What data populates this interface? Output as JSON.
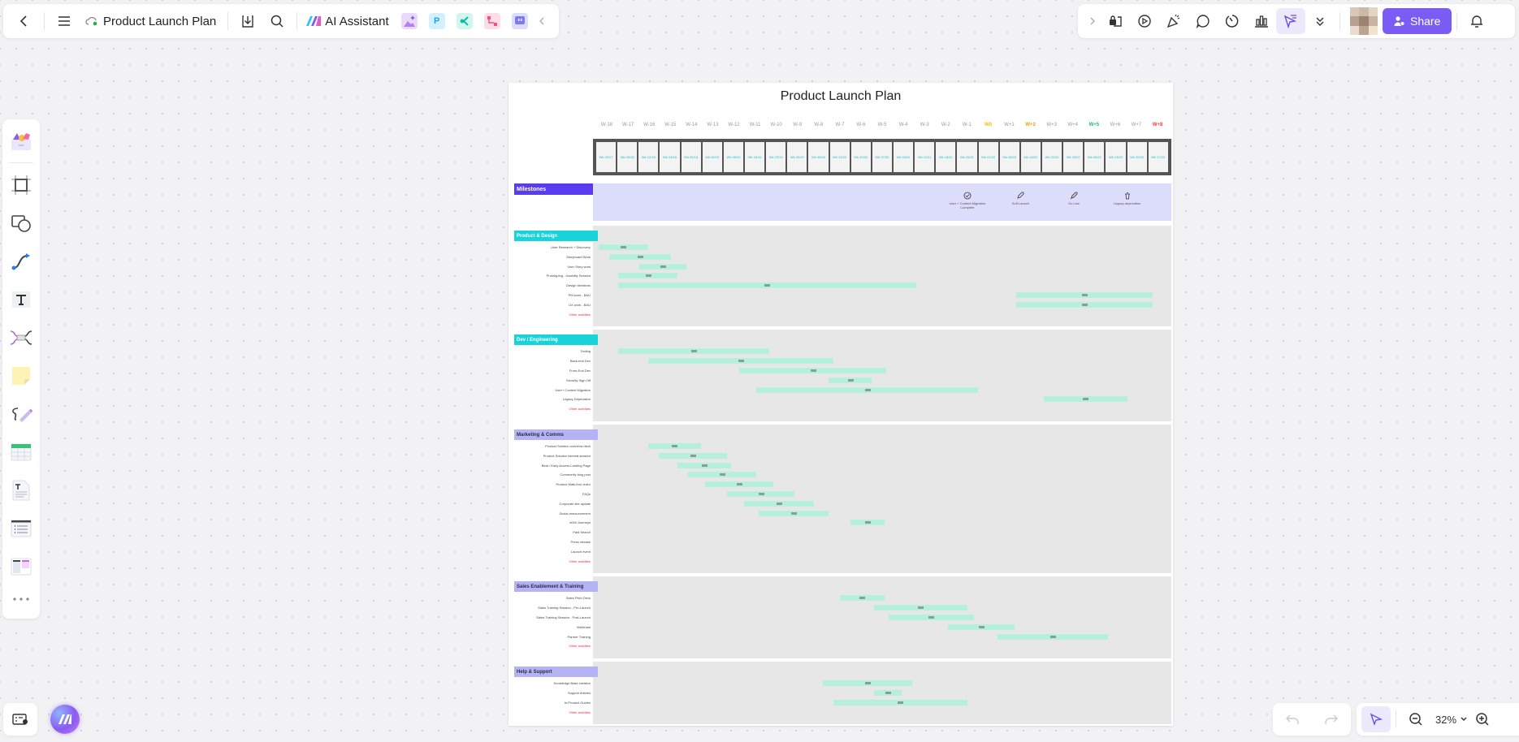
{
  "toolbar": {
    "doc_title": "Product Launch Plan",
    "ai_assistant_label": "AI Assistant",
    "share_label": "Share",
    "accent_color": "#7b5cf5"
  },
  "zoom": {
    "level": "32%"
  },
  "board": {
    "title": "Product Launch Plan",
    "weeks": [
      "W-18",
      "W-17",
      "W-16",
      "W-15",
      "W-14",
      "W-13",
      "W-12",
      "W-11",
      "W-10",
      "W-9",
      "W-8",
      "W-7",
      "W-6",
      "W-5",
      "W-4",
      "W-3",
      "W-2",
      "W-1",
      "W0",
      "W+1",
      "W+2",
      "W+3",
      "W+4",
      "W+5",
      "W+6",
      "W+7",
      "W+8"
    ],
    "week_colors": {
      "W0": "#f5c000",
      "W+2": "#f59a00",
      "W+5": "#19b88a",
      "W+8": "#f23b3b"
    },
    "dates": [
      "Wk 29/17",
      "Wk 05/18",
      "Wk 12/18",
      "Wk 19/18",
      "Wk 26/18",
      "Wk 02/19",
      "Wk 09/19",
      "Wk 16/19",
      "Wk 23/19",
      "Wk 30/19",
      "Wk 06/20",
      "Wk 13/20",
      "Wk 20/20",
      "Wk 27/20",
      "Wk 04/21",
      "Wk 11/21",
      "Wk 18/21",
      "Wk 25/21",
      "Wk 01/22",
      "Wk 08/22",
      "Wk 15/22",
      "Wk 22/22",
      "Wk 29/22",
      "Wk 06/23",
      "Wk 13/23",
      "Wk 20/23",
      "Wk 27/23"
    ],
    "milestones": {
      "label": "Milestones",
      "items": [
        {
          "label": "User + Content Migration Complete",
          "icon": "check-circle-icon",
          "week": 17.5
        },
        {
          "label": "Soft Launch",
          "icon": "rocket-icon",
          "week": 20
        },
        {
          "label": "Go Live",
          "icon": "rocket-launch-icon",
          "week": 22.5
        },
        {
          "label": "Legacy deprication",
          "icon": "trash-icon",
          "week": 25
        }
      ]
    },
    "sections": [
      {
        "name": "Product & Design",
        "color": "#19d3d9",
        "tasks": [
          {
            "label": "User Research + Discovery",
            "start": 0.2,
            "end": 2.5
          },
          {
            "label": "Storyboard Work",
            "start": 0.7,
            "end": 3.6
          },
          {
            "label": "User Story work",
            "start": 2.1,
            "end": 4.3
          },
          {
            "label": "Prototyping - Usability Session",
            "start": 1.1,
            "end": 3.9
          },
          {
            "label": "Design Iterations",
            "start": 1.1,
            "end": 15.1
          },
          {
            "label": "PM work - BAU",
            "start": 19.8,
            "end": 26.2
          },
          {
            "label": "UX work - BAU",
            "start": 19.8,
            "end": 26.2
          },
          {
            "label": "Other activities",
            "other": true
          }
        ]
      },
      {
        "name": "Dev / Engineering",
        "color": "#19d3d9",
        "tasks": [
          {
            "label": "Tooling",
            "start": 1.1,
            "end": 8.2
          },
          {
            "label": "Back-end Dev",
            "start": 2.5,
            "end": 11.2
          },
          {
            "label": "Front-End Dev",
            "start": 6.8,
            "end": 13.7
          },
          {
            "label": "Security Sign Off",
            "start": 11.0,
            "end": 13.0
          },
          {
            "label": "User+ Content Migration",
            "start": 7.6,
            "end": 18.0
          },
          {
            "label": "Legacy Deprication",
            "start": 21.1,
            "end": 25.0
          },
          {
            "label": "Other activities",
            "other": true
          }
        ]
      },
      {
        "name": "Marketing & Comms",
        "color": "#b6b3f5",
        "tasks": [
          {
            "label": "Product Solution overview deck",
            "start": 2.5,
            "end": 5.0
          },
          {
            "label": "Product Solution internal session",
            "start": 3.0,
            "end": 6.2
          },
          {
            "label": "Beta / Early Access Landing Page",
            "start": 3.9,
            "end": 6.4
          },
          {
            "label": "Community blog post",
            "start": 4.4,
            "end": 7.6
          },
          {
            "label": "Product Walk-thru video",
            "start": 5.2,
            "end": 8.4
          },
          {
            "label": "FAQs",
            "start": 6.2,
            "end": 9.4
          },
          {
            "label": "Corporate site update",
            "start": 7.0,
            "end": 10.3
          },
          {
            "label": "Social announcement",
            "start": 7.7,
            "end": 11.0
          },
          {
            "label": "eDM Journeys",
            "start": 12.0,
            "end": 13.6
          },
          {
            "label": "Paid Search"
          },
          {
            "label": "Press release"
          },
          {
            "label": "Launch event"
          },
          {
            "label": "Other activities",
            "other": true
          }
        ]
      },
      {
        "name": "Sales Enablement & Training",
        "color": "#b6b3f5",
        "tasks": [
          {
            "label": "Sales Pitch Deck",
            "start": 11.5,
            "end": 13.6
          },
          {
            "label": "Sales Training Session - Pre-Launch",
            "start": 13.1,
            "end": 17.5
          },
          {
            "label": "Sales Training Session - Post-Launch",
            "start": 13.8,
            "end": 17.8
          },
          {
            "label": "Webinars",
            "start": 16.6,
            "end": 19.7
          },
          {
            "label": "Partner Training",
            "start": 18.9,
            "end": 24.1
          },
          {
            "label": "Other activities",
            "other": true
          }
        ]
      },
      {
        "name": "Help & Support",
        "color": "#b6b3f5",
        "tasks": [
          {
            "label": "Knowledge Base creation",
            "start": 10.7,
            "end": 14.9
          },
          {
            "label": "Support Articles",
            "start": 13.1,
            "end": 14.4
          },
          {
            "label": "In-Product Guides",
            "start": 11.2,
            "end": 17.5
          },
          {
            "label": "Other activities",
            "other": true
          }
        ]
      }
    ]
  }
}
